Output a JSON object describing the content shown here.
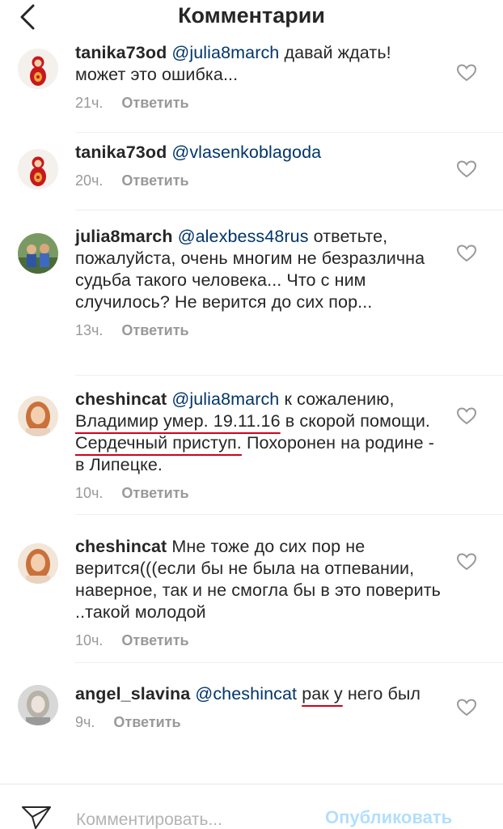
{
  "header": {
    "title": "Комментарии"
  },
  "comments": [
    {
      "username": "tanika73od",
      "mention": "@julia8march",
      "text": " давай ждать! может это ошибка...",
      "time": "21ч.",
      "reply": "Ответить",
      "avatar": "matryoshka-avatar"
    },
    {
      "username": "tanika73od",
      "mention": "@vlasenkoblagoda",
      "text": "",
      "time": "20ч.",
      "reply": "Ответить",
      "avatar": "matryoshka-avatar"
    },
    {
      "username": "julia8march",
      "mention": "@alexbess48rus",
      "text": " ответьте, пожалуйста, очень многим не безразлична судьба такого человека... Что с ним случилось? Не верится до сих пор...",
      "time": "13ч.",
      "reply": "Ответить",
      "avatar": "kids-photo-avatar"
    },
    {
      "username": "cheshincat",
      "mention": "@julia8march",
      "text_a": " к сожалению, ",
      "marked_1": "Владимир умер. 19.11.16",
      "text_b": " в скорой помощи. ",
      "marked_2": "Сердечный приступ.",
      "text_c": " Похоронен на родине - в Липецке.",
      "time": "10ч.",
      "reply": "Ответить",
      "avatar": "red-hair-woman-avatar"
    },
    {
      "username": "cheshincat",
      "text": "Мне тоже до сих пор не верится(((если бы не была на отпевании, наверное, так и не смогла бы в это поверить ..такой молодой",
      "time": "10ч.",
      "reply": "Ответить",
      "avatar": "red-hair-woman-avatar"
    },
    {
      "username": "angel_slavina",
      "mention": "@cheshincat",
      "marked": "рак у",
      "text": " него был",
      "time": "9ч.",
      "reply": "Ответить",
      "avatar": "blonde-woman-avatar"
    }
  ],
  "footer": {
    "placeholder": "Комментировать...",
    "publish_label": "Опубликовать"
  },
  "colors": {
    "text": "#262626",
    "mention": "#003569",
    "meta": "#999999",
    "publish": "#b2dffc",
    "highlight_underline": "#d0021b"
  }
}
